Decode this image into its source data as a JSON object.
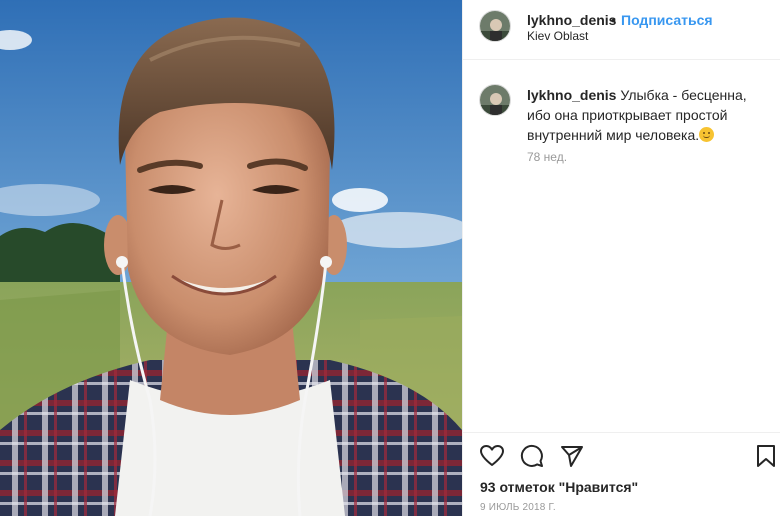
{
  "post": {
    "username": "lykhno_denis",
    "follow_separator": "•",
    "follow_label": "Подписаться",
    "location": "Kiev Oblast"
  },
  "caption": {
    "username": "lykhno_denis",
    "text": "Улыбка - бесценна, ибо она приоткрывает простой внутренний мир человека.",
    "emoji": "smiling-face",
    "time_ago": "78 нед."
  },
  "actions": {
    "like_icon": "heart-icon",
    "comment_icon": "comment-icon",
    "share_icon": "share-icon",
    "save_icon": "bookmark-icon"
  },
  "stats": {
    "likes_text": "93 отметок \"Нравится\"",
    "date_text": "9 ИЮЛЬ 2018 Г."
  },
  "colors": {
    "accent": "#3897f0",
    "text": "#262626",
    "muted": "#999999",
    "border": "#efefef"
  }
}
